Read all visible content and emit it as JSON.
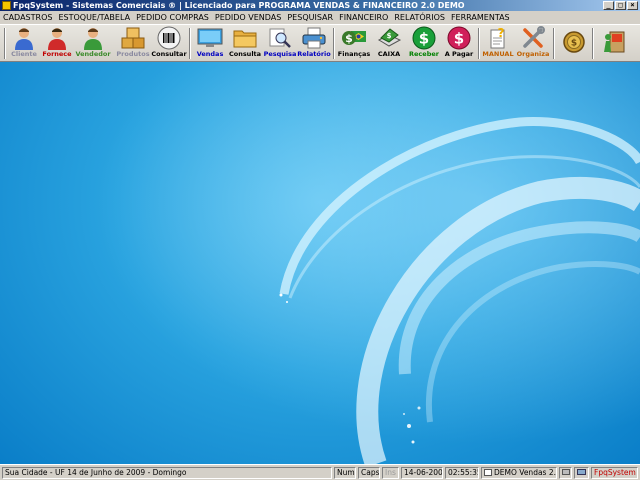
{
  "window": {
    "title": "FpqSystem - Sistemas Comerciais ® | Licenciado para PROGRAMA VENDAS & FINANCEIRO 2.0 DEMO",
    "min_glyph": "_",
    "max_glyph": "□",
    "close_glyph": "×"
  },
  "menu": [
    {
      "label": "CADASTROS"
    },
    {
      "label": "ESTOQUE/TABELA"
    },
    {
      "label": "PEDIDO COMPRAS"
    },
    {
      "label": "PEDIDO VENDAS"
    },
    {
      "label": "PESQUISAR"
    },
    {
      "label": "FINANCEIRO"
    },
    {
      "label": "RELATÓRIOS"
    },
    {
      "label": "FERRAMENTAS"
    }
  ],
  "toolbar": {
    "cliente": {
      "label": "Cliente",
      "icon": "person-blue-icon",
      "color": "#8a8aa0"
    },
    "fornece": {
      "label": "Fornece",
      "icon": "person-red-icon",
      "color": "#c00000"
    },
    "vendedor": {
      "label": "Vendedor",
      "icon": "person-green-icon",
      "color": "#3a8a2a"
    },
    "produtos": {
      "label": "Produtos",
      "icon": "boxes-icon",
      "color": "#8a8aa0"
    },
    "consultar": {
      "label": "Consultar",
      "icon": "barcode-icon",
      "color": "#000000"
    },
    "vendas": {
      "label": "Vendas",
      "icon": "monitor-icon",
      "color": "#0000c0"
    },
    "consulta": {
      "label": "Consulta",
      "icon": "folder-icon",
      "color": "#000000"
    },
    "pesquisa": {
      "label": "Pesquisa",
      "icon": "magnifier-icon",
      "color": "#0000c0"
    },
    "relatorio": {
      "label": "Relatório",
      "icon": "printer-icon",
      "color": "#0000c0"
    },
    "financas": {
      "label": "Finanças",
      "icon": "money-flag-icon",
      "color": "#000000"
    },
    "caixa": {
      "label": "CAIXA",
      "icon": "cash-box-icon",
      "color": "#000000"
    },
    "receber": {
      "label": "Receber",
      "icon": "dollar-green-icon",
      "color": "#008000"
    },
    "apagar": {
      "label": "A Pagar",
      "icon": "dollar-red-icon",
      "color": "#000000"
    },
    "manual": {
      "label": "MANUAL",
      "icon": "help-document-icon",
      "color": "#c06000"
    },
    "organiza": {
      "label": "Organiza",
      "icon": "tools-icon",
      "color": "#c06000"
    },
    "coin": {
      "label": "",
      "icon": "coin-icon"
    },
    "exit": {
      "label": "",
      "icon": "exit-door-icon"
    }
  },
  "statusbar": {
    "location": "Sua Cidade - UF 14 de Junho de 2009 - Domingo",
    "num": "Num",
    "caps": "Caps",
    "ins": "Ins",
    "date": "14-06-2009",
    "time": "02:55:35",
    "edition": "DEMO Vendas 2.0",
    "brand": "FpqSystem",
    "brand_color": "#c00000"
  }
}
